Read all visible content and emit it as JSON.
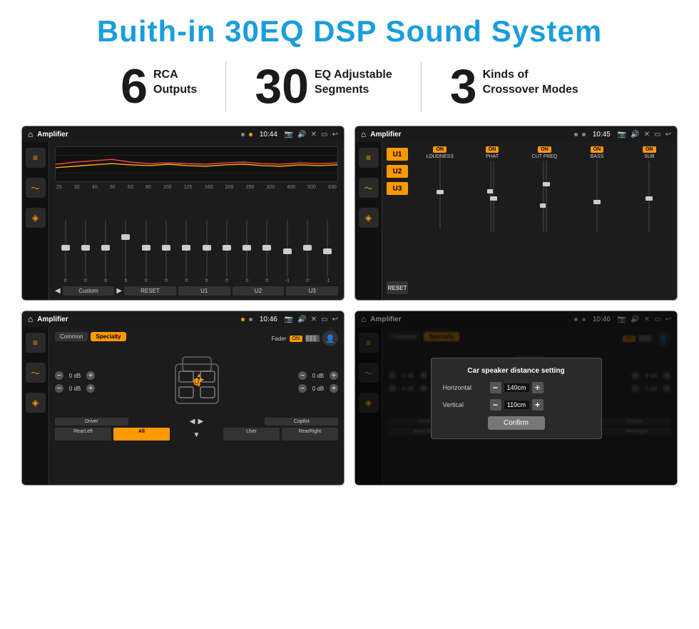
{
  "header": {
    "title": "Buith-in 30EQ DSP Sound System"
  },
  "stats": [
    {
      "number": "6",
      "line1": "RCA",
      "line2": "Outputs"
    },
    {
      "number": "30",
      "line1": "EQ Adjustable",
      "line2": "Segments"
    },
    {
      "number": "3",
      "line1": "Kinds of",
      "line2": "Crossover Modes"
    }
  ],
  "screens": [
    {
      "id": "eq-screen",
      "title": "Amplifier",
      "time": "10:44",
      "eq_labels": [
        "25",
        "32",
        "40",
        "50",
        "63",
        "80",
        "100",
        "125",
        "160",
        "200",
        "250",
        "320",
        "400",
        "500",
        "630"
      ],
      "eq_values": [
        "0",
        "0",
        "0",
        "5",
        "0",
        "0",
        "0",
        "0",
        "0",
        "0",
        "0",
        "-1",
        "0",
        "-1"
      ],
      "bottom_btns": [
        "Custom",
        "RESET",
        "U1",
        "U2",
        "U3"
      ]
    },
    {
      "id": "mixer-screen",
      "title": "Amplifier",
      "time": "10:45",
      "u_items": [
        "U1",
        "U2",
        "U3"
      ],
      "channels": [
        "LOUDNESS",
        "PHAT",
        "CUT FREQ",
        "BASS",
        "SUB"
      ],
      "reset_label": "RESET"
    },
    {
      "id": "fader-screen",
      "title": "Amplifier",
      "time": "10:46",
      "tabs": [
        "Common",
        "Specialty"
      ],
      "fader_label": "Fader",
      "on_label": "ON",
      "db_left_top": "0 dB",
      "db_left_bot": "0 dB",
      "db_right_top": "0 dB",
      "db_right_bot": "0 dB",
      "bottom_btns": [
        "Driver",
        "",
        "",
        "User",
        "Copilot",
        "RearLeft",
        "All",
        "RearRight"
      ]
    },
    {
      "id": "dialog-screen",
      "title": "Amplifier",
      "time": "10:46",
      "tabs": [
        "Common",
        "Specialty"
      ],
      "dialog": {
        "title": "Car speaker distance setting",
        "horizontal_label": "Horizontal",
        "horizontal_value": "140cm",
        "vertical_label": "Vertical",
        "vertical_value": "110cm",
        "confirm_label": "Confirm"
      },
      "db_right_top": "0 dB",
      "db_right_bot": "0 dB",
      "bottom_btns_visible": [
        "Driver",
        "Copilot",
        "RearLeft",
        "All",
        "User",
        "RearRight"
      ]
    }
  ]
}
